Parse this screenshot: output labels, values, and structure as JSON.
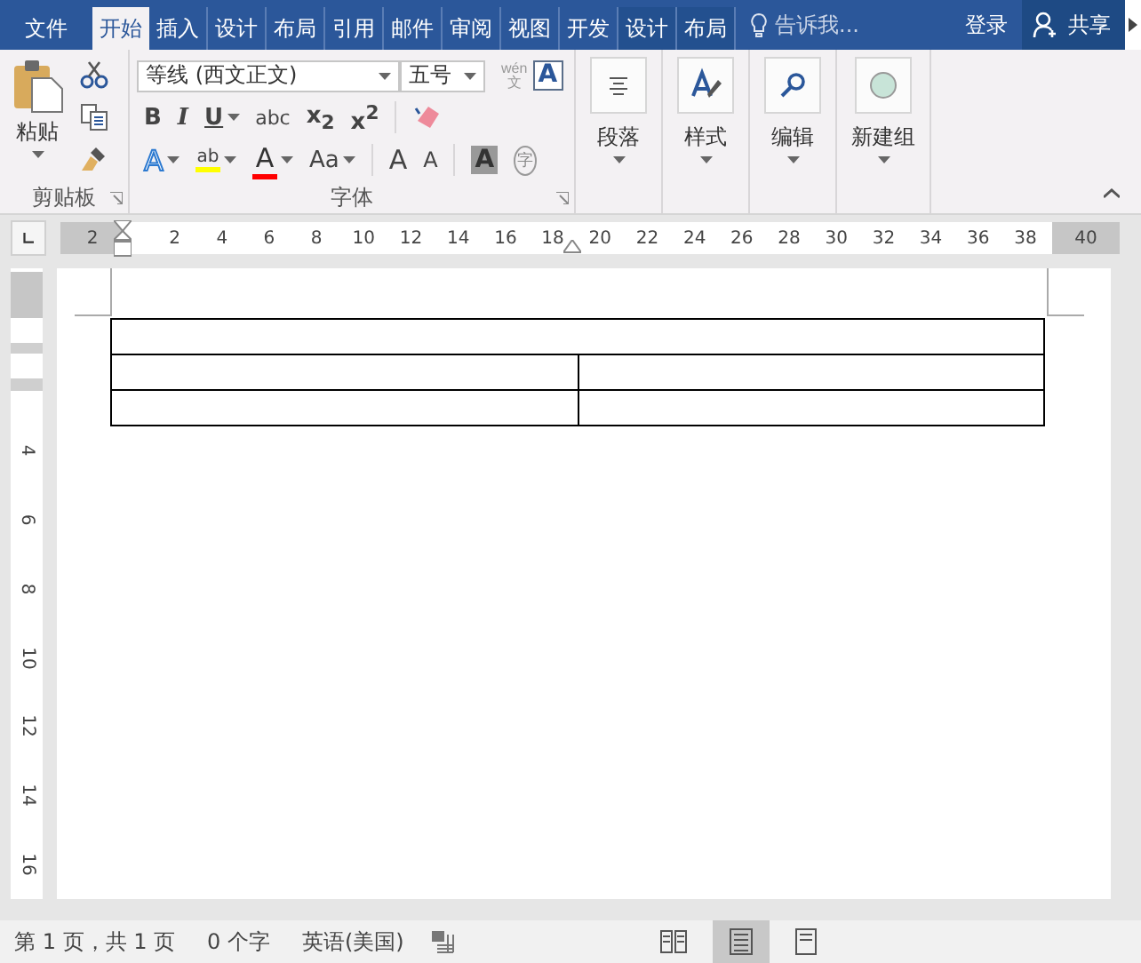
{
  "tabs": [
    {
      "label": "文件",
      "selected": false,
      "kind": "file"
    },
    {
      "label": "开始",
      "selected": true,
      "kind": "normal"
    },
    {
      "label": "插入",
      "selected": false,
      "kind": "normal"
    },
    {
      "label": "设计",
      "selected": false,
      "kind": "normal"
    },
    {
      "label": "布局",
      "selected": false,
      "kind": "normal"
    },
    {
      "label": "引用",
      "selected": false,
      "kind": "normal"
    },
    {
      "label": "邮件",
      "selected": false,
      "kind": "normal"
    },
    {
      "label": "审阅",
      "selected": false,
      "kind": "normal"
    },
    {
      "label": "视图",
      "selected": false,
      "kind": "normal"
    },
    {
      "label": "开发",
      "selected": false,
      "kind": "normal"
    },
    {
      "label": "设计",
      "selected": false,
      "kind": "contextual"
    },
    {
      "label": "布局",
      "selected": false,
      "kind": "contextual"
    }
  ],
  "tell_me": {
    "placeholder": "告诉我..."
  },
  "sign_in": "登录",
  "share": "共享",
  "ribbon": {
    "clipboard": {
      "label": "剪贴板",
      "paste": "粘贴"
    },
    "font": {
      "label": "字体",
      "font_name": "等线 (西文正文)",
      "font_size": "五号",
      "phonetic_top": "wén",
      "phonetic_bottom": "文",
      "border_glyph": "A",
      "format_buttons": [
        {
          "kind": "bold",
          "glyph": "B"
        },
        {
          "kind": "italic",
          "glyph": "I"
        },
        {
          "kind": "underline",
          "glyph": "U"
        },
        {
          "kind": "strike",
          "glyph": "abc"
        },
        {
          "kind": "sub",
          "glyph": "x$_{2}$"
        },
        {
          "kind": "sup",
          "glyph": "x$^{2}$"
        }
      ],
      "style_buttons": [
        {
          "kind": "effects",
          "glyph": "A"
        },
        {
          "kind": "highlight",
          "glyph": "ab",
          "color": "#ffff00"
        },
        {
          "kind": "color",
          "glyph": "A",
          "color": "#ff0000"
        },
        {
          "kind": "case",
          "glyph": "Aa"
        },
        {
          "kind": "grow",
          "glyph": "A"
        },
        {
          "kind": "shrink",
          "glyph": "A"
        },
        {
          "kind": "shading",
          "glyph": "A"
        },
        {
          "kind": "enclose",
          "glyph": "字"
        }
      ]
    },
    "groups": [
      {
        "label": "段落",
        "kind": "paragraph"
      },
      {
        "label": "样式",
        "kind": "styles"
      },
      {
        "label": "编辑",
        "kind": "editing"
      },
      {
        "label": "新建组",
        "kind": "new"
      }
    ]
  },
  "ruler": {
    "numbers": [
      {
        "label": "2",
        "kind": "margin"
      },
      {
        "label": "2",
        "kind": "text"
      },
      {
        "label": "4",
        "kind": "text"
      },
      {
        "label": "6",
        "kind": "text"
      },
      {
        "label": "8",
        "kind": "text"
      },
      {
        "label": "10",
        "kind": "text"
      },
      {
        "label": "12",
        "kind": "text"
      },
      {
        "label": "14",
        "kind": "text"
      },
      {
        "label": "16",
        "kind": "text"
      },
      {
        "label": "18",
        "kind": "text"
      },
      {
        "label": "20",
        "kind": "text"
      },
      {
        "label": "22",
        "kind": "text"
      },
      {
        "label": "24",
        "kind": "text"
      },
      {
        "label": "26",
        "kind": "text"
      },
      {
        "label": "28",
        "kind": "text"
      },
      {
        "label": "30",
        "kind": "text"
      },
      {
        "label": "32",
        "kind": "text"
      },
      {
        "label": "34",
        "kind": "text"
      },
      {
        "label": "36",
        "kind": "text"
      },
      {
        "label": "38",
        "kind": "text"
      },
      {
        "label": "40",
        "kind": "margin"
      }
    ],
    "vertical_numbers": [
      "4",
      "6",
      "8",
      "10",
      "12",
      "14",
      "16"
    ]
  },
  "table": {
    "rows": [
      {
        "merged": true
      },
      {
        "merged": false
      },
      {
        "merged": false
      }
    ]
  },
  "status_bar": {
    "page": "第 1 页，共 1 页",
    "words": "0 个字",
    "language": "英语(美国)",
    "views": [
      {
        "kind": "read",
        "selected": false
      },
      {
        "kind": "print",
        "selected": true
      },
      {
        "kind": "web",
        "selected": false
      }
    ]
  }
}
